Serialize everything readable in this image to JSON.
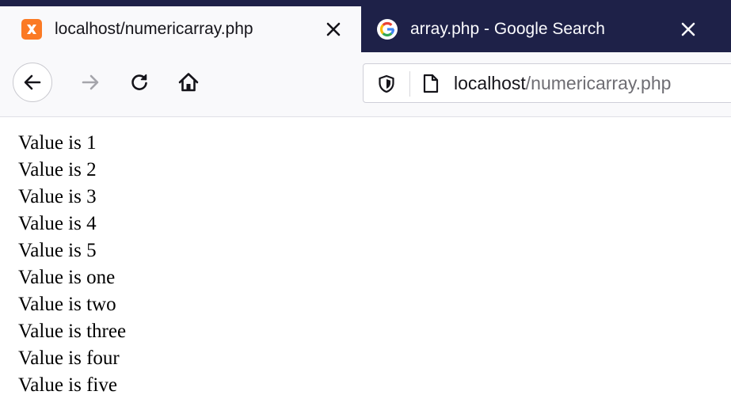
{
  "tabs": [
    {
      "title": "localhost/numericarray.php",
      "icon": "xampp-icon",
      "active": true
    },
    {
      "title": "array.php - Google Search",
      "icon": "google-icon",
      "active": false
    }
  ],
  "toolbar": {
    "url_host": "localhost",
    "url_path": "/numericarray.php"
  },
  "page": {
    "lines": [
      "Value is 1",
      "Value is 2",
      "Value is 3",
      "Value is 4",
      "Value is 5",
      "Value is one",
      "Value is two",
      "Value is three",
      "Value is four",
      "Value is five"
    ]
  },
  "colors": {
    "tabstrip_bg": "#1e2148",
    "active_tab_bg": "#f9f9fb",
    "xampp_orange": "#fb7a24"
  }
}
